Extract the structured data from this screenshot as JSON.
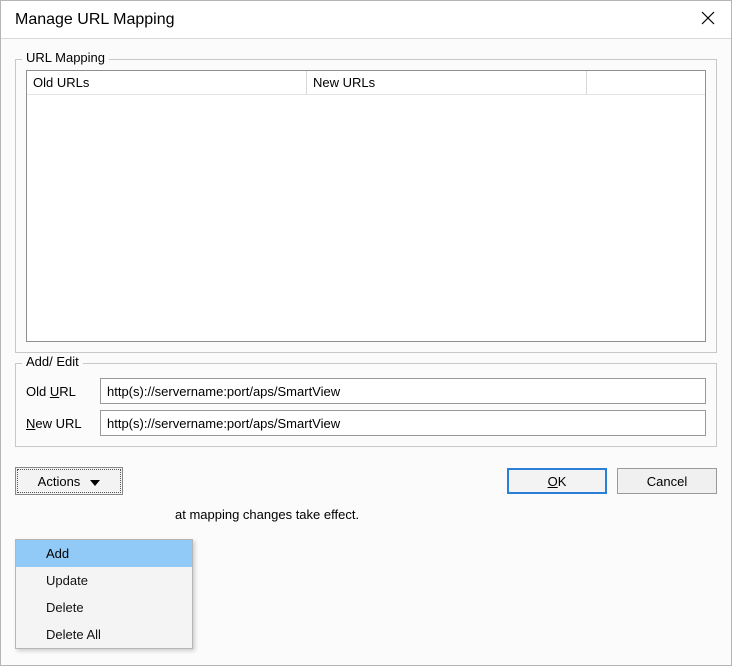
{
  "dialog": {
    "title": "Manage URL Mapping"
  },
  "url_mapping": {
    "legend": "URL Mapping",
    "columns": {
      "old": "Old URLs",
      "new": "New URLs"
    },
    "rows": []
  },
  "add_edit": {
    "legend": "Add/ Edit",
    "old_label_pre": "Old ",
    "old_label_u": "U",
    "old_label_post": "RL",
    "new_label_pre": "",
    "new_label_u": "N",
    "new_label_post": "ew URL",
    "old_value": "http(s)://servername:port/aps/SmartView",
    "new_value": "http(s)://servername:port/aps/SmartView"
  },
  "buttons": {
    "actions_pre": "",
    "actions_u": "A",
    "actions_post": "ctions",
    "ok_pre": "",
    "ok_u": "O",
    "ok_post": "K",
    "cancel": "Cancel"
  },
  "note_visible": "at mapping changes take effect.",
  "actions_menu": {
    "items": [
      {
        "label": "Add",
        "hover": true
      },
      {
        "label": "Update",
        "hover": false
      },
      {
        "label": "Delete",
        "hover": false
      },
      {
        "label": "Delete All",
        "hover": false
      }
    ]
  }
}
